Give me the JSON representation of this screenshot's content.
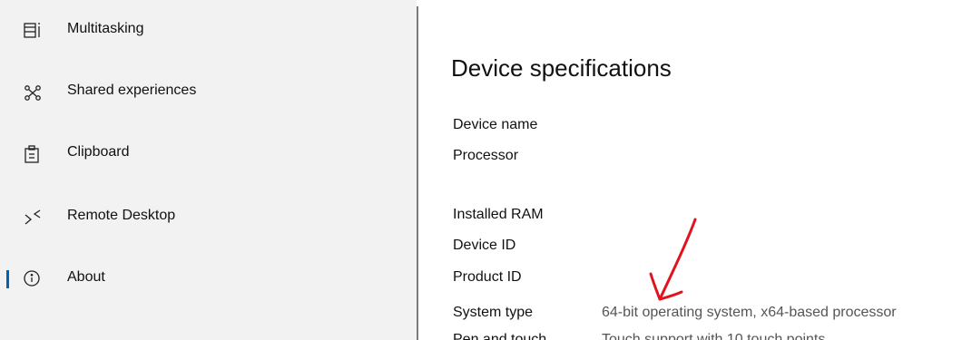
{
  "sidebar": {
    "items": [
      {
        "label": "Multitasking",
        "icon": "multitasking-icon"
      },
      {
        "label": "Shared experiences",
        "icon": "shared-experiences-icon"
      },
      {
        "label": "Clipboard",
        "icon": "clipboard-icon"
      },
      {
        "label": "Remote Desktop",
        "icon": "remote-desktop-icon"
      },
      {
        "label": "About",
        "icon": "info-icon",
        "selected": true
      }
    ]
  },
  "main": {
    "heading": "Device specifications",
    "specs": [
      {
        "label": "Device name",
        "value": ""
      },
      {
        "label": "Processor",
        "value": ""
      },
      {
        "label": "Installed RAM",
        "value": ""
      },
      {
        "label": "Device ID",
        "value": ""
      },
      {
        "label": "Product ID",
        "value": ""
      },
      {
        "label": "System type",
        "value": "64-bit operating system, x64-based processor"
      },
      {
        "label": "Pen and touch",
        "value": "Touch support with 10 touch points"
      }
    ]
  },
  "annotation": {
    "type": "hand-drawn-arrow",
    "color": "#e0141e"
  },
  "colors": {
    "accent": "#0063b1",
    "sidebar_bg": "#f2f2f2",
    "value_text": "#555555"
  }
}
